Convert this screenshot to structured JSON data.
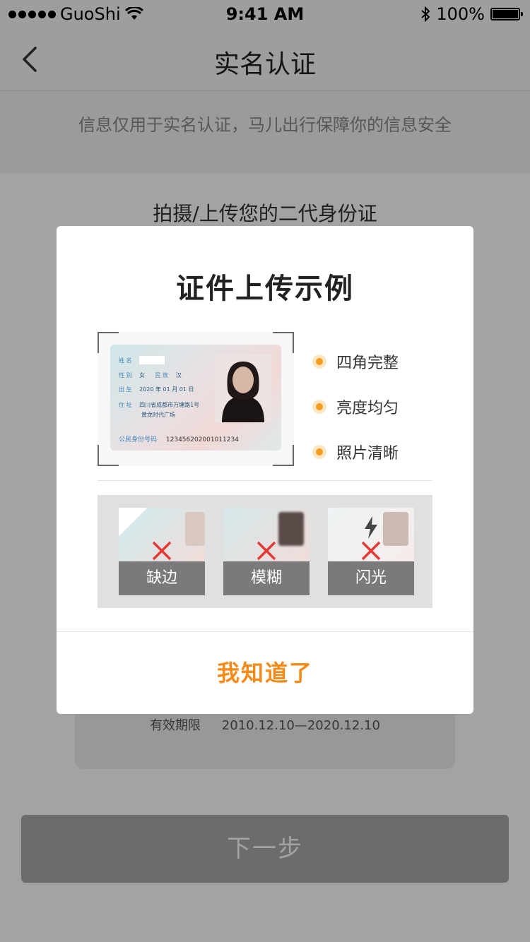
{
  "status_bar": {
    "carrier": "GuoShi",
    "time": "9:41 AM",
    "battery": "100%"
  },
  "nav": {
    "title": "实名认证"
  },
  "info_text": "信息仅用于实名认证，马儿出行保障你的信息安全",
  "section_title": "拍摄/上传您的二代身份证",
  "id_back": {
    "validity_label": "有效期限",
    "validity_value": "2010.12.10—2020.12.10"
  },
  "next_button": "下一步",
  "modal": {
    "title": "证件上传示例",
    "sample_card": {
      "name_label": "姓 名",
      "gender_label": "性 别",
      "gender": "女",
      "ethnicity_label": "民 族",
      "ethnicity": "汉",
      "birth_label": "出 生",
      "birth": "2020 年 01 月 01 日",
      "address_label": "住 址",
      "address_line1": "四川省成都市万塘路1号",
      "address_line2": "黄龙时代广场",
      "id_label": "公民身份号码",
      "id_number": "123456202001011234"
    },
    "checks": [
      "四角完整",
      "亮度均匀",
      "照片清晰"
    ],
    "bad_examples": [
      "缺边",
      "模糊",
      "闪光"
    ],
    "confirm_button": "我知道了"
  },
  "colors": {
    "accent": "#f58a16",
    "check_dot": "#f59e1d",
    "error_x": "#e53935",
    "disabled_button": "#a7a9ad"
  }
}
